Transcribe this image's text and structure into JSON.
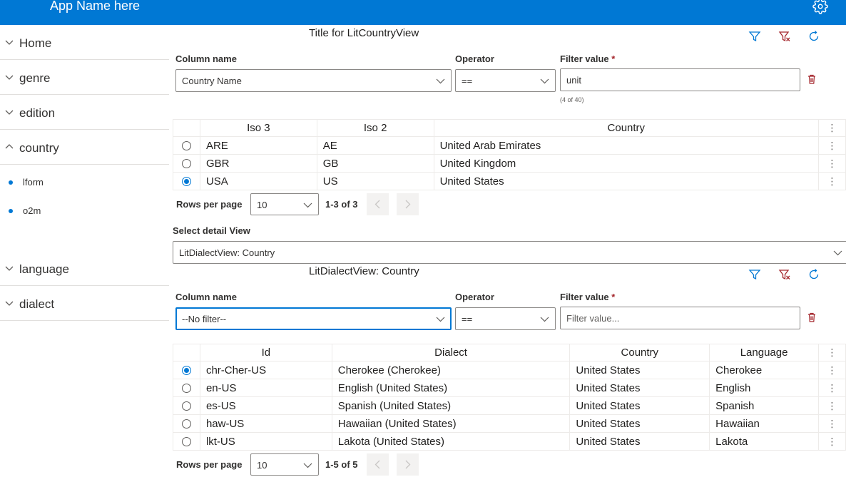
{
  "app": {
    "title": "App Name here"
  },
  "sidebar": {
    "items": [
      {
        "label": "Home"
      },
      {
        "label": "genre"
      },
      {
        "label": "edition"
      },
      {
        "label": "country",
        "subitems": [
          {
            "label": "lform"
          },
          {
            "label": "o2m"
          }
        ]
      },
      {
        "label": "language"
      },
      {
        "label": "dialect"
      }
    ]
  },
  "country_view": {
    "title": "Title for LitCountryView",
    "filter": {
      "column_label": "Column name",
      "column_value": "Country Name",
      "operator_label": "Operator",
      "operator_value": "==",
      "value_label": "Filter value",
      "required_mark": "*",
      "value": "unit",
      "placeholder": "Filter value...",
      "count_hint": "(4 of 40)"
    },
    "columns": [
      "Iso 3",
      "Iso 2",
      "Country"
    ],
    "rows": [
      {
        "iso3": "ARE",
        "iso2": "AE",
        "country": "United Arab Emirates",
        "selected": false
      },
      {
        "iso3": "GBR",
        "iso2": "GB",
        "country": "United Kingdom",
        "selected": false
      },
      {
        "iso3": "USA",
        "iso2": "US",
        "country": "United States",
        "selected": true
      }
    ],
    "pagination": {
      "rows_label": "Rows per page",
      "rows_value": "10",
      "range": "1-3 of 3"
    }
  },
  "detail_select": {
    "label": "Select detail View",
    "value": "LitDialectView: Country"
  },
  "dialect_view": {
    "title": "LitDialectView: Country",
    "filter": {
      "column_label": "Column name",
      "column_value": "--No filter--",
      "operator_label": "Operator",
      "operator_value": "==",
      "value_label": "Filter value",
      "required_mark": "*",
      "value": "",
      "placeholder": "Filter value..."
    },
    "columns": [
      "Id",
      "Dialect",
      "Country",
      "Language"
    ],
    "rows": [
      {
        "id": "chr-Cher-US",
        "dialect": "Cherokee (Cherokee)",
        "country": "United States",
        "language": "Cherokee",
        "selected": true
      },
      {
        "id": "en-US",
        "dialect": "English (United States)",
        "country": "United States",
        "language": "English",
        "selected": false
      },
      {
        "id": "es-US",
        "dialect": "Spanish (United States)",
        "country": "United States",
        "language": "Spanish",
        "selected": false
      },
      {
        "id": "haw-US",
        "dialect": "Hawaiian (United States)",
        "country": "United States",
        "language": "Hawaiian",
        "selected": false
      },
      {
        "id": "lkt-US",
        "dialect": "Lakota (United States)",
        "country": "United States",
        "language": "Lakota",
        "selected": false
      }
    ],
    "pagination": {
      "rows_label": "Rows per page",
      "rows_value": "10",
      "range": "1-5 of 5"
    }
  },
  "icons": {
    "settings": "gear-icon",
    "filter": "filter-icon",
    "clear_filter": "clear-filter-icon",
    "refresh": "refresh-icon",
    "delete": "trash-icon",
    "row_menu": "more-vertical-icon"
  },
  "colors": {
    "accent": "#0078d4",
    "danger": "#a4262c",
    "text": "#201f1e",
    "border": "#8a8886"
  }
}
